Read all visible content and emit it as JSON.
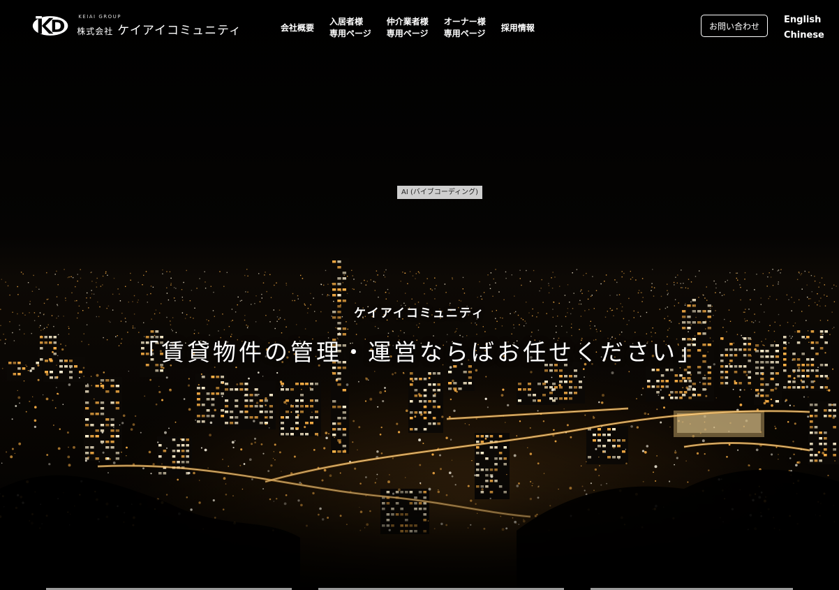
{
  "header": {
    "logo": {
      "group_label": "KEIAI GROUP",
      "prefix": "株式会社",
      "name": "ケイアイコミュニティ"
    },
    "nav": [
      {
        "id": "company",
        "lines": [
          "会社概要"
        ]
      },
      {
        "id": "resident",
        "lines": [
          "入居者様",
          "専用ページ"
        ]
      },
      {
        "id": "agent",
        "lines": [
          "仲介業者様",
          "専用ページ"
        ]
      },
      {
        "id": "owner",
        "lines": [
          "オーナー様",
          "専用ページ"
        ]
      },
      {
        "id": "recruit",
        "lines": [
          "採用情報"
        ]
      }
    ],
    "contact_label": "お問い合わせ",
    "languages": [
      "English",
      "Chinese"
    ]
  },
  "badge": {
    "text": "AI (バイブコーディング)"
  },
  "hero": {
    "subtitle": "ケイアイコミュニティ",
    "title": "「賃貸物件の管理・運営ならばお任せください」",
    "background": "night-city-skyline-photo"
  },
  "colors": {
    "background": "#000000",
    "text": "#ffffff",
    "badge_bg": "#cfcfcf",
    "city_light": "#ffb347"
  }
}
